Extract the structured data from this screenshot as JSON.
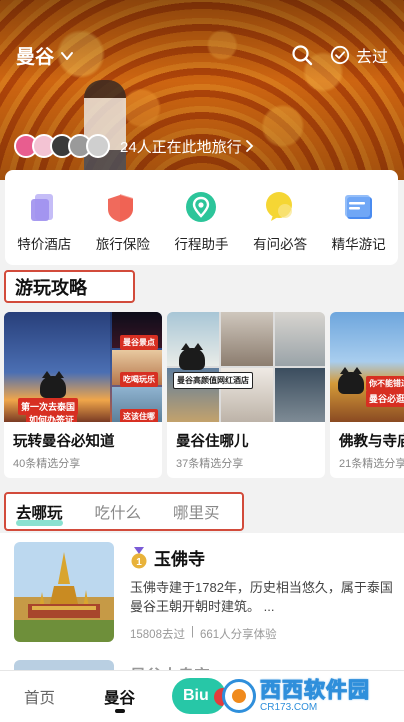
{
  "header": {
    "city": "曼谷",
    "been_label": "去过"
  },
  "travelers": {
    "text": "24人正在此地旅行",
    "avatar_colors": [
      "#e85d8f",
      "#f3c3d3",
      "#3b3b3b",
      "#9a9a9a",
      "#cfcfcf"
    ]
  },
  "services": [
    {
      "label": "特价酒店",
      "icon": "hotel-icon",
      "color": "#a99cf0"
    },
    {
      "label": "旅行保险",
      "icon": "insurance-icon",
      "color": "#f06a5c"
    },
    {
      "label": "行程助手",
      "icon": "itinerary-icon",
      "color": "#2cc59a"
    },
    {
      "label": "有问必答",
      "icon": "qa-icon",
      "color": "#f2d22c"
    },
    {
      "label": "精华游记",
      "icon": "travelogue-icon",
      "color": "#4a8bf0"
    }
  ],
  "guide_section": {
    "title": "游玩攻略",
    "cards": [
      {
        "title": "玩转曼谷必知道",
        "subtitle": "40条精选分享",
        "overlay_lines": [
          "第一次去泰国",
          "如何办签证"
        ],
        "tile_badges": [
          "曼谷景点",
          "吃喝玩乐",
          "这该住哪"
        ]
      },
      {
        "title": "曼谷住哪儿",
        "subtitle": "37条精选分享",
        "overlay_lines": [
          "曼谷高颜值网红酒店"
        ]
      },
      {
        "title": "佛教与寺庙",
        "subtitle": "21条精选分享",
        "overlay_lines": [
          "你不能错过的",
          "曼谷必逛"
        ]
      }
    ]
  },
  "tabs": [
    "去哪玩",
    "吃什么",
    "哪里买"
  ],
  "poi": {
    "rank": "1",
    "name": "玉佛寺",
    "description": "玉佛寺建于1782年，历史相当悠久，属于泰国曼谷王朝开朝时建筑。 ...",
    "visits": "15808去过",
    "separator": "|",
    "shares": "661人分享体验"
  },
  "next_poi": {
    "name": "曼谷大皇宫"
  },
  "bottom_nav": {
    "home": "首页",
    "city": "曼谷",
    "center": "Biu"
  },
  "watermark": {
    "main": "西西软件园",
    "sub": "CR173.COM"
  }
}
